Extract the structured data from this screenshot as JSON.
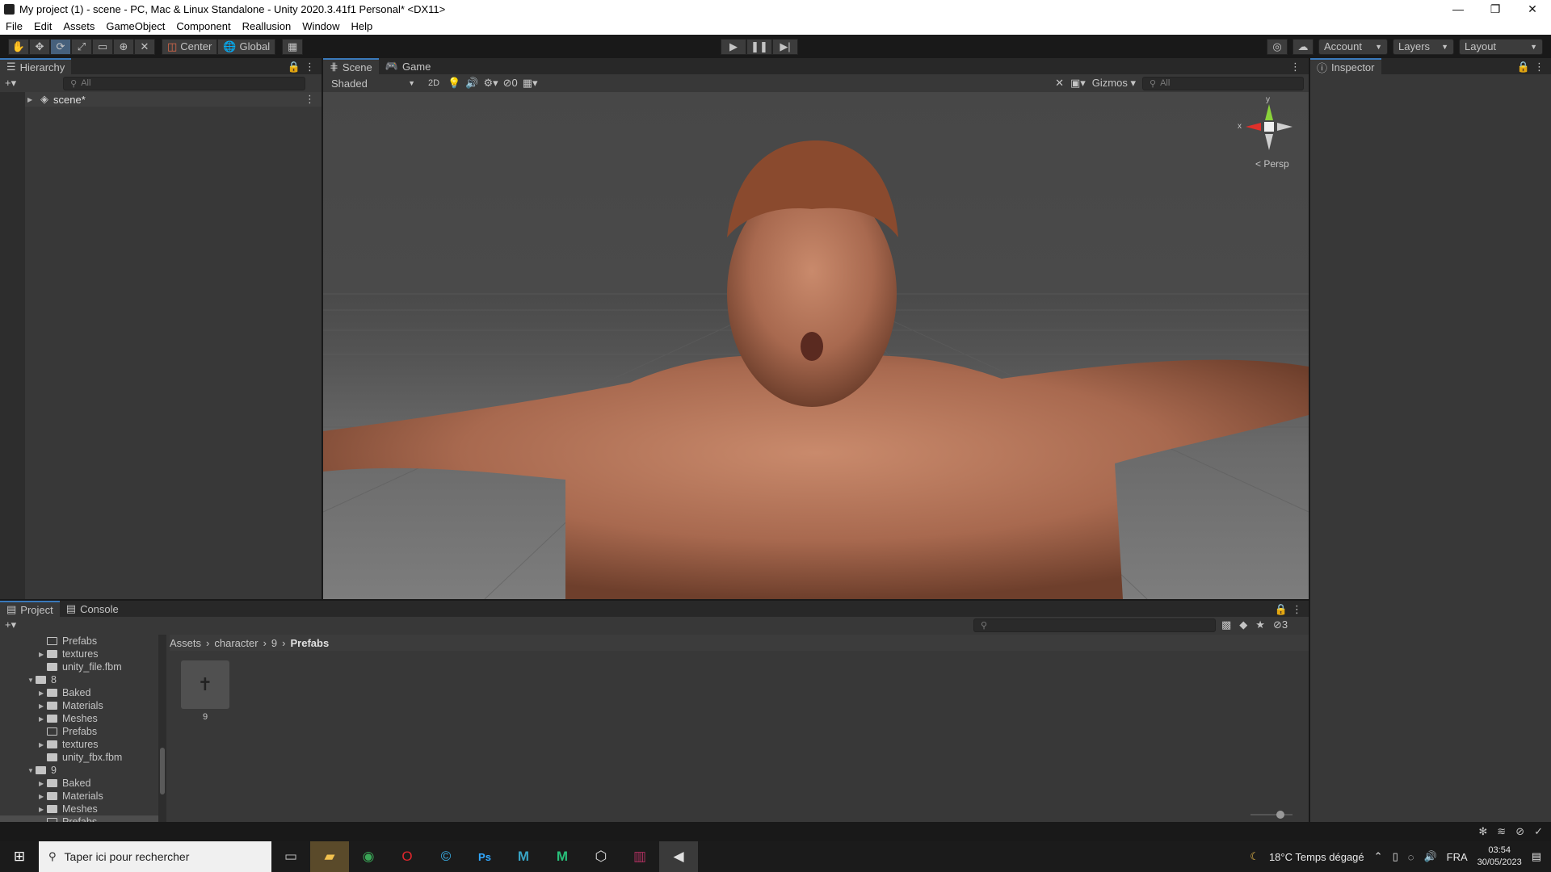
{
  "window": {
    "title": "My project (1) - scene - PC, Mac & Linux Standalone - Unity 2020.3.41f1 Personal* <DX11>",
    "min": "—",
    "max": "❐",
    "close": "✕"
  },
  "menu": [
    "File",
    "Edit",
    "Assets",
    "GameObject",
    "Component",
    "Reallusion",
    "Window",
    "Help"
  ],
  "toolbar": {
    "center": "Center",
    "global": "Global",
    "account": "Account",
    "layers": "Layers",
    "layout": "Layout"
  },
  "hierarchy": {
    "tab": "Hierarchy",
    "search_placeholder": "All",
    "scene": "scene*"
  },
  "scene_view": {
    "tabs": [
      "Scene",
      "Game"
    ],
    "shading": "Shaded",
    "mode2d": "2D",
    "hidden_count": "0",
    "gizmos": "Gizmos",
    "search_placeholder": "All",
    "axis_y": "y",
    "axis_x": "x",
    "persp": "Persp"
  },
  "inspector": {
    "tab": "Inspector"
  },
  "project": {
    "tabs": [
      "Project",
      "Console"
    ],
    "hidden_count": "3",
    "breadcrumb": [
      "Assets",
      "character",
      "9",
      "Prefabs"
    ],
    "tree": [
      {
        "label": "Prefabs",
        "indent": 3,
        "arrow": "",
        "empty": true
      },
      {
        "label": "textures",
        "indent": 3,
        "arrow": "▶",
        "empty": false
      },
      {
        "label": "unity_file.fbm",
        "indent": 3,
        "arrow": "",
        "empty": false
      },
      {
        "label": "8",
        "indent": 2,
        "arrow": "▼",
        "empty": false
      },
      {
        "label": "Baked",
        "indent": 3,
        "arrow": "▶",
        "empty": false
      },
      {
        "label": "Materials",
        "indent": 3,
        "arrow": "▶",
        "empty": false
      },
      {
        "label": "Meshes",
        "indent": 3,
        "arrow": "▶",
        "empty": false
      },
      {
        "label": "Prefabs",
        "indent": 3,
        "arrow": "",
        "empty": true
      },
      {
        "label": "textures",
        "indent": 3,
        "arrow": "▶",
        "empty": false
      },
      {
        "label": "unity_fbx.fbm",
        "indent": 3,
        "arrow": "",
        "empty": false
      },
      {
        "label": "9",
        "indent": 2,
        "arrow": "▼",
        "empty": false
      },
      {
        "label": "Baked",
        "indent": 3,
        "arrow": "▶",
        "empty": false
      },
      {
        "label": "Materials",
        "indent": 3,
        "arrow": "▶",
        "empty": false
      },
      {
        "label": "Meshes",
        "indent": 3,
        "arrow": "▶",
        "empty": false
      },
      {
        "label": "Prefabs",
        "indent": 3,
        "arrow": "",
        "empty": true
      }
    ],
    "asset_label": "9"
  },
  "taskbar": {
    "search_placeholder": "Taper ici pour rechercher",
    "weather": "18°C  Temps dégagé",
    "lang": "FRA",
    "time": "03:54",
    "date": "30/05/2023"
  },
  "colors": {
    "accent": "#3a79bb",
    "panel": "#383838",
    "dark": "#191919"
  }
}
